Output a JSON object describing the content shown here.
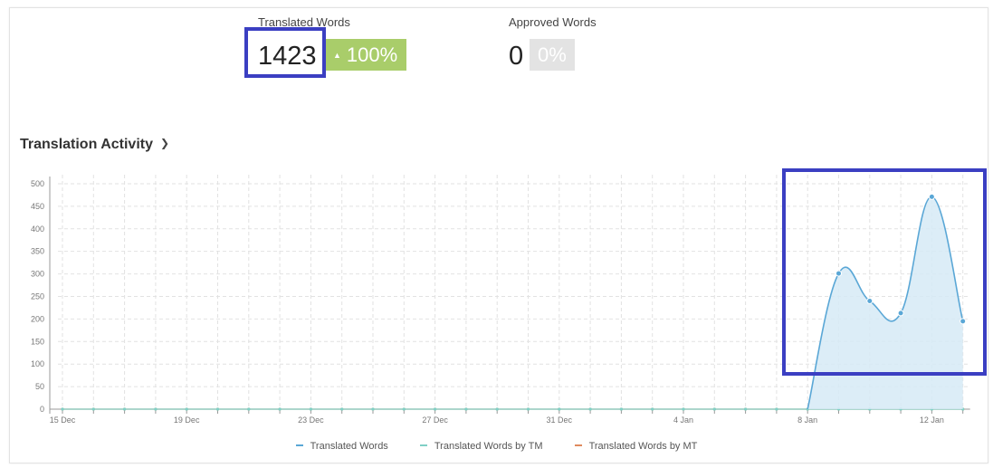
{
  "stats": {
    "translated": {
      "label": "Translated Words",
      "value": "1423",
      "badge": "100%",
      "badge_color": "#a9cd6a"
    },
    "approved": {
      "label": "Approved Words",
      "value": "0",
      "badge": "0%",
      "badge_color": "#e3e3e3"
    }
  },
  "section": {
    "title": "Translation Activity",
    "toggle_icon": "chevron-down-icon"
  },
  "colors": {
    "highlight": "#3b3fc2",
    "series_translated": "#5aa7d6",
    "series_tm": "#7fd0c6",
    "series_mt": "#e08a5e",
    "area_fill": "#d6eaf6"
  },
  "chart_data": {
    "type": "area",
    "x": [
      "15 Dec",
      "16 Dec",
      "17 Dec",
      "18 Dec",
      "19 Dec",
      "20 Dec",
      "21 Dec",
      "22 Dec",
      "23 Dec",
      "24 Dec",
      "25 Dec",
      "26 Dec",
      "27 Dec",
      "28 Dec",
      "29 Dec",
      "30 Dec",
      "31 Dec",
      "1 Jan",
      "2 Jan",
      "3 Jan",
      "4 Jan",
      "5 Jan",
      "6 Jan",
      "7 Jan",
      "8 Jan",
      "9 Jan",
      "10 Jan",
      "11 Jan",
      "12 Jan",
      "13 Jan"
    ],
    "x_tick_labels": [
      "15 Dec",
      "19 Dec",
      "23 Dec",
      "27 Dec",
      "31 Dec",
      "4 Jan",
      "8 Jan",
      "12 Jan"
    ],
    "y_ticks": [
      0,
      50,
      100,
      150,
      200,
      250,
      300,
      350,
      400,
      450,
      500
    ],
    "ylim": [
      0,
      520
    ],
    "grid": true,
    "legend_position": "bottom",
    "series": [
      {
        "name": "Translated Words",
        "values": [
          0,
          0,
          0,
          0,
          0,
          0,
          0,
          0,
          0,
          0,
          0,
          0,
          0,
          0,
          0,
          0,
          0,
          0,
          0,
          0,
          0,
          0,
          0,
          0,
          0,
          301,
          240,
          213,
          471,
          195
        ]
      },
      {
        "name": "Translated Words by TM",
        "values": [
          0,
          0,
          0,
          0,
          0,
          0,
          0,
          0,
          0,
          0,
          0,
          0,
          0,
          0,
          0,
          0,
          0,
          0,
          0,
          0,
          0,
          0,
          0,
          0,
          0,
          0,
          0,
          0,
          0,
          0
        ]
      },
      {
        "name": "Translated Words by MT",
        "values": [
          0,
          0,
          0,
          0,
          0,
          0,
          0,
          0,
          0,
          0,
          0,
          0,
          0,
          0,
          0,
          0,
          0,
          0,
          0,
          0,
          0,
          0,
          0,
          0,
          0,
          0,
          0,
          0,
          0,
          0
        ]
      }
    ]
  }
}
